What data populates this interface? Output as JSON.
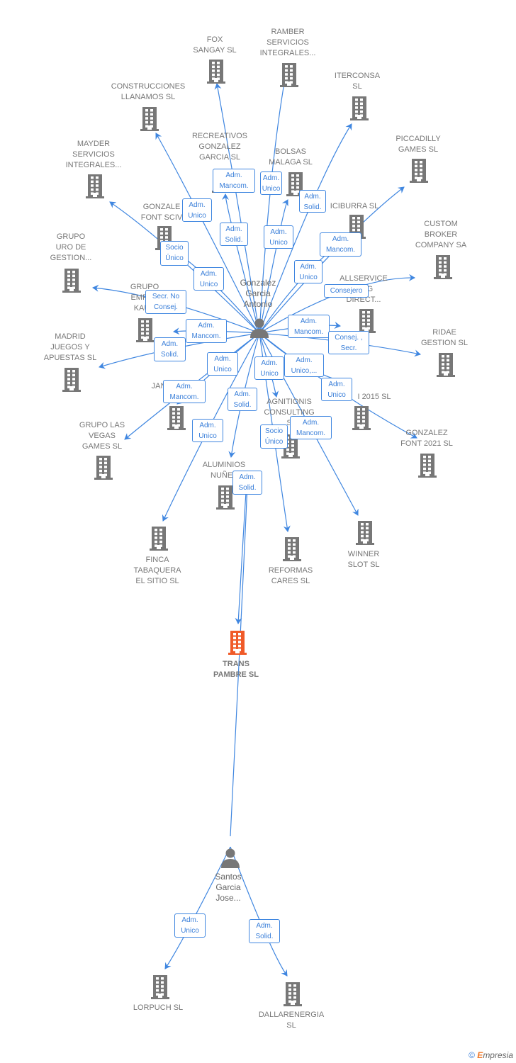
{
  "colors": {
    "edge": "#3f86e0",
    "building": "#777777",
    "highlight": "#f05a28",
    "person": "#777777"
  },
  "persons": [
    {
      "name": [
        "Gonzalez",
        "Garcia",
        "Antonio"
      ]
    },
    {
      "name": [
        "Santos",
        "Garcia",
        "Jose..."
      ]
    }
  ],
  "companies": [
    {
      "name": [
        "FOX",
        "SANGAY  SL"
      ],
      "role": [
        "Adm.",
        "Mancom."
      ]
    },
    {
      "name": [
        "RAMBER",
        "SERVICIOS",
        "INTEGRALES..."
      ],
      "role": [
        "Adm.",
        "Unico"
      ]
    },
    {
      "name": [
        "ITERCONSA",
        "SL"
      ],
      "role": [
        "Adm.",
        "Solid."
      ]
    },
    {
      "name": [
        "CONSTRUCCIONES",
        "LLANAMOS SL"
      ],
      "role": [
        "Adm.",
        "Unico"
      ]
    },
    {
      "name": [
        "PICCADILLY",
        "GAMES  SL"
      ],
      "role": [
        "Adm.",
        "Mancom."
      ]
    },
    {
      "name": [
        "MAYDER",
        "SERVICIOS",
        "INTEGRALES..."
      ],
      "role": [
        "Socio",
        "Único"
      ]
    },
    {
      "name": [
        "RECREATIVOS",
        "GONZALEZ",
        "GARCIA SL"
      ],
      "role": [
        "Adm.",
        "Solid."
      ]
    },
    {
      "name": [
        "BOLSAS",
        "MALAGA SL"
      ],
      "role": [
        "Adm.",
        "Unico"
      ]
    },
    {
      "name": [
        "GONZALE",
        "FONT SCIV"
      ],
      "role": [
        "Adm.",
        "Unico"
      ]
    },
    {
      "name": [
        "ICIBURRA SL"
      ],
      "role": [
        "Adm.",
        "Unico"
      ]
    },
    {
      "name": [
        "GRUPO",
        "URO DE",
        "GESTION..."
      ],
      "role": [
        "Secr.  No",
        "Consej."
      ]
    },
    {
      "name": [
        "CUSTOM",
        "BROKER",
        "COMPANY SA"
      ],
      "role": [
        "Consejero"
      ]
    },
    {
      "name": [
        "ALLSERVICE",
        "TING",
        "DIRECT..."
      ],
      "role": [
        "Adm.",
        "Mancom."
      ]
    },
    {
      "name": [
        "GRUPO",
        "EMPRE",
        "KAUR"
      ],
      "role": [
        "Adm.",
        "Mancom."
      ]
    },
    {
      "name": [
        "MADRID",
        "JUEGOS Y",
        "APUESTAS  SL"
      ],
      "role": [
        "Adm.",
        "Solid."
      ]
    },
    {
      "name": [
        "RIDAE",
        "GESTION SL"
      ],
      "role": [
        "Consej. ,",
        "Secr."
      ]
    },
    {
      "name": [
        "JAN"
      ],
      "role": [
        "Adm.",
        "Unico"
      ]
    },
    {
      "name": [
        "GRUPO LAS",
        "VEGAS",
        "GAMES  SL"
      ],
      "role": [
        "Adm.",
        "Mancom."
      ]
    },
    {
      "name": [
        "I 2015  SL"
      ],
      "role": [
        "Adm.",
        "Unico,..."
      ]
    },
    {
      "name": [
        "GONZALEZ",
        "FONT 2021  SL"
      ],
      "role": [
        "Adm.",
        "Unico"
      ]
    },
    {
      "name": [
        "AGNITIONIS",
        "CONSULTING",
        "S"
      ],
      "role": [
        "Adm.",
        "Unico"
      ]
    },
    {
      "name": [
        "ALUMINIOS",
        "NUÑEZ"
      ],
      "role": [
        "Adm.",
        "Solid."
      ]
    },
    {
      "name": [
        "FINCA",
        "TABAQUERA",
        "EL SITIO SL"
      ],
      "role": [
        "Adm.",
        "Unico"
      ]
    },
    {
      "name": [
        "REFORMAS",
        "CARES  SL"
      ],
      "role": [
        "Socio",
        "Único"
      ]
    },
    {
      "name": [
        "WINNER",
        "SLOT  SL"
      ],
      "role": [
        "Adm.",
        "Mancom."
      ]
    },
    {
      "name": [
        "TRANS",
        "PAMBRE  SL"
      ],
      "role": [
        "Adm.",
        "Solid."
      ],
      "highlight": true
    },
    {
      "name": [
        "LORPUCH SL"
      ],
      "role": [
        "Adm.",
        "Unico"
      ]
    },
    {
      "name": [
        "DALLARENERGIA",
        "SL"
      ],
      "role": [
        "Adm.",
        "Solid."
      ]
    }
  ],
  "footer": {
    "copyright": "©",
    "brand_e": "E",
    "brand_rest": "mpresia"
  }
}
